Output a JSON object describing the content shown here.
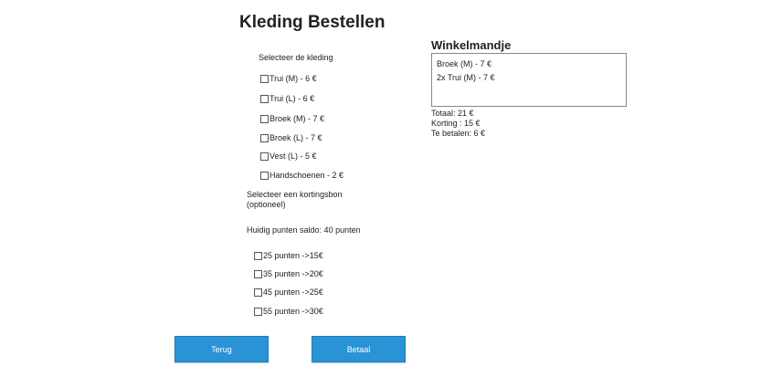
{
  "page": {
    "title": "Kleding Bestellen"
  },
  "clothing": {
    "label": "Selecteer de kleding",
    "items": [
      {
        "label": "Trui (M) -  6 €"
      },
      {
        "label": "Trui (L) - 6 €"
      },
      {
        "label": "Broek (M) - 7 €"
      },
      {
        "label": "Broek (L) - 7 €"
      },
      {
        "label": "Vest (L) - 5 €"
      },
      {
        "label": "Handschoenen - 2 €"
      }
    ]
  },
  "discount": {
    "label_line1": "Selecteer een kortingsbon",
    "label_line2": "(optioneel)",
    "balance": "Huidig punten saldo: 40 punten",
    "options": [
      {
        "label": "25 punten ->15€"
      },
      {
        "label": "35 punten ->20€"
      },
      {
        "label": "45 punten ->25€"
      },
      {
        "label": "55 punten ->30€"
      }
    ]
  },
  "cart": {
    "title": "Winkelmandje",
    "items": [
      {
        "label": "Broek (M) - 7 €"
      },
      {
        "label": "2x Trui (M) - 7 €"
      }
    ],
    "total": "Totaal: 21 €",
    "discount": "Korting : 15 €",
    "to_pay": "Te betalen: 6 €"
  },
  "buttons": {
    "back": "Terug",
    "pay": "Betaal"
  },
  "colors": {
    "button_bg": "#2a93d5",
    "button_text": "#ffffff"
  }
}
